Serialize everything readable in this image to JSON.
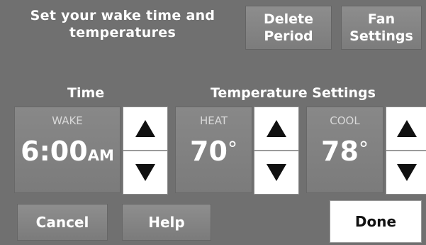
{
  "header": {
    "title_line1": "Set your wake time and",
    "title_line2": "temperatures",
    "delete_line1": "Delete",
    "delete_line2": "Period",
    "fan_line1": "Fan",
    "fan_line2": "Settings"
  },
  "sections": {
    "time_title": "Time",
    "temp_title": "Temperature Settings"
  },
  "wake": {
    "label": "WAKE",
    "time": "6:00",
    "ampm": "AM"
  },
  "heat": {
    "label": "HEAT",
    "value": "70",
    "unit": "°"
  },
  "cool": {
    "label": "COOL",
    "value": "78",
    "unit": "°"
  },
  "buttons": {
    "cancel": "Cancel",
    "help": "Help",
    "done": "Done"
  },
  "icons": {
    "up": "arrow-up-icon",
    "down": "arrow-down-icon"
  },
  "colors": {
    "background": "#707070",
    "button": "#848484",
    "done_bg": "#ffffff",
    "text": "#ffffff"
  }
}
